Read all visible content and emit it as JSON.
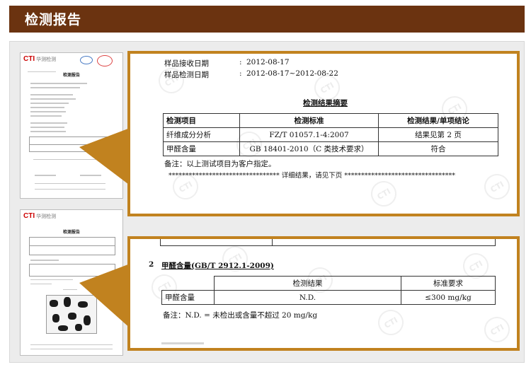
{
  "header": {
    "title": "检测报告"
  },
  "thumb1": {
    "logo_mark": "CTI",
    "logo_text": "华测检测",
    "doc_title": "检测报告"
  },
  "thumb2": {
    "logo_mark": "CTI",
    "logo_text": "华测检测",
    "doc_title": "检测报告"
  },
  "zoom1": {
    "receive_label": "样品接收日期",
    "receive_colon": ":",
    "receive_value": "2012-08-17",
    "test_label": "样品检测日期",
    "test_colon": ":",
    "test_value": "2012-08-17~2012-08-22",
    "summary_title": "检测结果摘要",
    "table": {
      "headers": [
        "检测项目",
        "检测标准",
        "检测结果/单项结论"
      ],
      "rows": [
        [
          "纤维成分分析",
          "FZ/T 01057.1-4:2007",
          "结果见第 2 页"
        ],
        [
          "甲醛含量",
          "GB 18401-2010（C 类技术要求）",
          "符合"
        ]
      ]
    },
    "note": "备注：以上测试项目为客户指定。",
    "divider_line": "********************************* 详细结果，请见下页 *********************************"
  },
  "zoom2": {
    "section_number": "2",
    "section_title": "甲醛含量(GB/T 2912.1-2009)",
    "table": {
      "headers": [
        "",
        "检测结果",
        "标准要求"
      ],
      "rows": [
        [
          "甲醛含量",
          "N.D.",
          "≤300 mg/kg"
        ]
      ]
    },
    "note": "备注：N.D. = 未检出或含量不超过 20 mg/kg"
  },
  "colors": {
    "header_bg": "#6b3310",
    "accent_border": "#c1821f",
    "panel_bg": "#ececec"
  }
}
